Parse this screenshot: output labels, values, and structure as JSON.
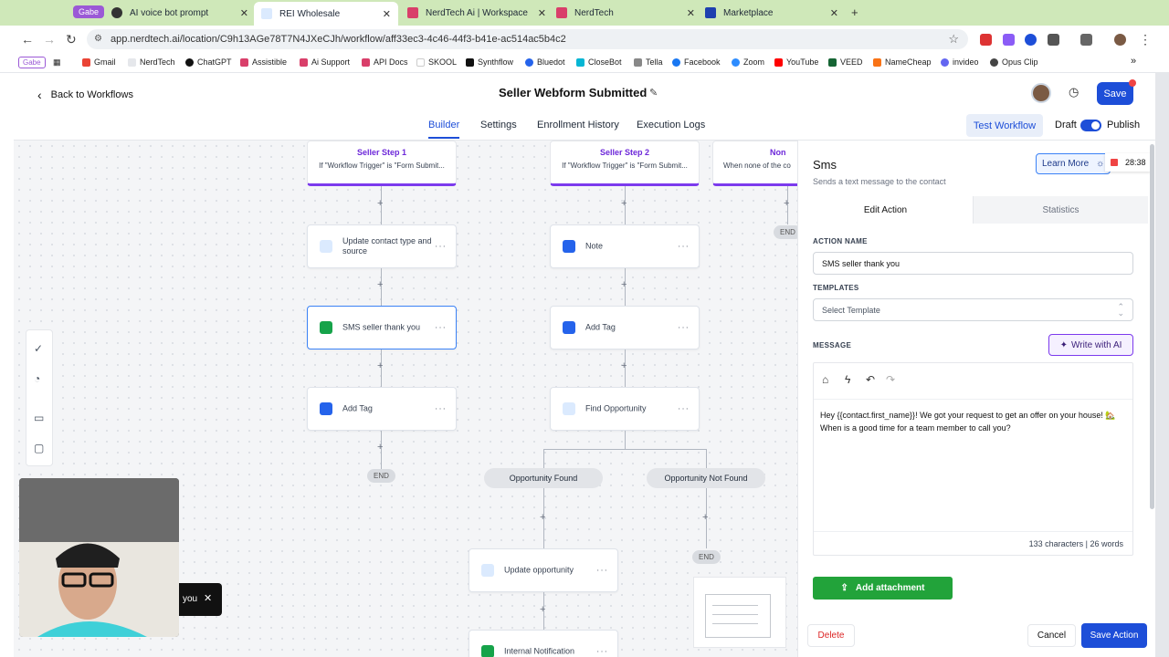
{
  "browser": {
    "tabs": [
      {
        "label": "AI voice bot prompt"
      },
      {
        "label": "REI Wholesale"
      },
      {
        "label": "NerdTech Ai | Workspace"
      },
      {
        "label": "NerdTech"
      },
      {
        "label": "Marketplace"
      }
    ],
    "tab_group": "Gabe",
    "url": "app.nerdtech.ai/location/C9h13AGe78T7N4JXeCJh/workflow/aff33ec3-4c46-44f3-b41e-ac514ac5b4c2",
    "bookmarks_group": "Gabe",
    "bookmarks": [
      "Gmail",
      "NerdTech",
      "ChatGPT",
      "Assistible",
      "Ai Support",
      "API Docs",
      "SKOOL",
      "Synthflow",
      "Bluedot",
      "CloseBot",
      "Tella",
      "Facebook",
      "Zoom",
      "YouTube",
      "VEED",
      "NameCheap",
      "invideo",
      "Opus Clip"
    ]
  },
  "header": {
    "back_label": "Back to Workflows",
    "title": "Seller Webform Submitted",
    "save_label": "Save"
  },
  "subnav": {
    "tabs": [
      "Builder",
      "Settings",
      "Enrollment History",
      "Execution Logs"
    ],
    "test_workflow": "Test Workflow",
    "draft": "Draft",
    "publish": "Publish"
  },
  "canvas": {
    "triggers": [
      {
        "title": "Seller Step 1",
        "condition": "If \"Workflow Trigger\" is \"Form Submit..."
      },
      {
        "title": "Seller Step 2",
        "condition": "If \"Workflow Trigger\" is \"Form Submit..."
      },
      {
        "title": "Non",
        "condition": "When none of the co"
      }
    ],
    "col1": [
      "Update contact type and source",
      "SMS seller thank you",
      "Add Tag"
    ],
    "col2": [
      "Note",
      "Add Tag",
      "Find Opportunity"
    ],
    "branches": [
      "Opportunity Found",
      "Opportunity Not Found"
    ],
    "col2_found": [
      "Update opportunity",
      "Internal Notification"
    ],
    "end_label": "END",
    "toast_text": "you"
  },
  "panel": {
    "title": "Sms",
    "subtitle": "Sends a text message to the contact",
    "learn_more": "Learn More",
    "timer": "28:38",
    "tabs": [
      "Edit Action",
      "Statistics"
    ],
    "action_name_label": "ACTION NAME",
    "action_name_value": "SMS seller thank you",
    "templates_label": "TEMPLATES",
    "templates_placeholder": "Select Template",
    "message_label": "MESSAGE",
    "write_ai": "Write with AI",
    "message_text": "Hey {{contact.first_name}}! We got your request to get an offer on your house! 🏡  When is a good time for a team member to call you?",
    "count": "133 characters | 26 words",
    "attach": "Add attachment",
    "delete": "Delete",
    "cancel": "Cancel",
    "save_action": "Save Action"
  },
  "colors": {
    "accent": "#1d4ed8",
    "trigger": "#7c3aed",
    "green": "#22a33a",
    "danger": "#dc2626"
  }
}
